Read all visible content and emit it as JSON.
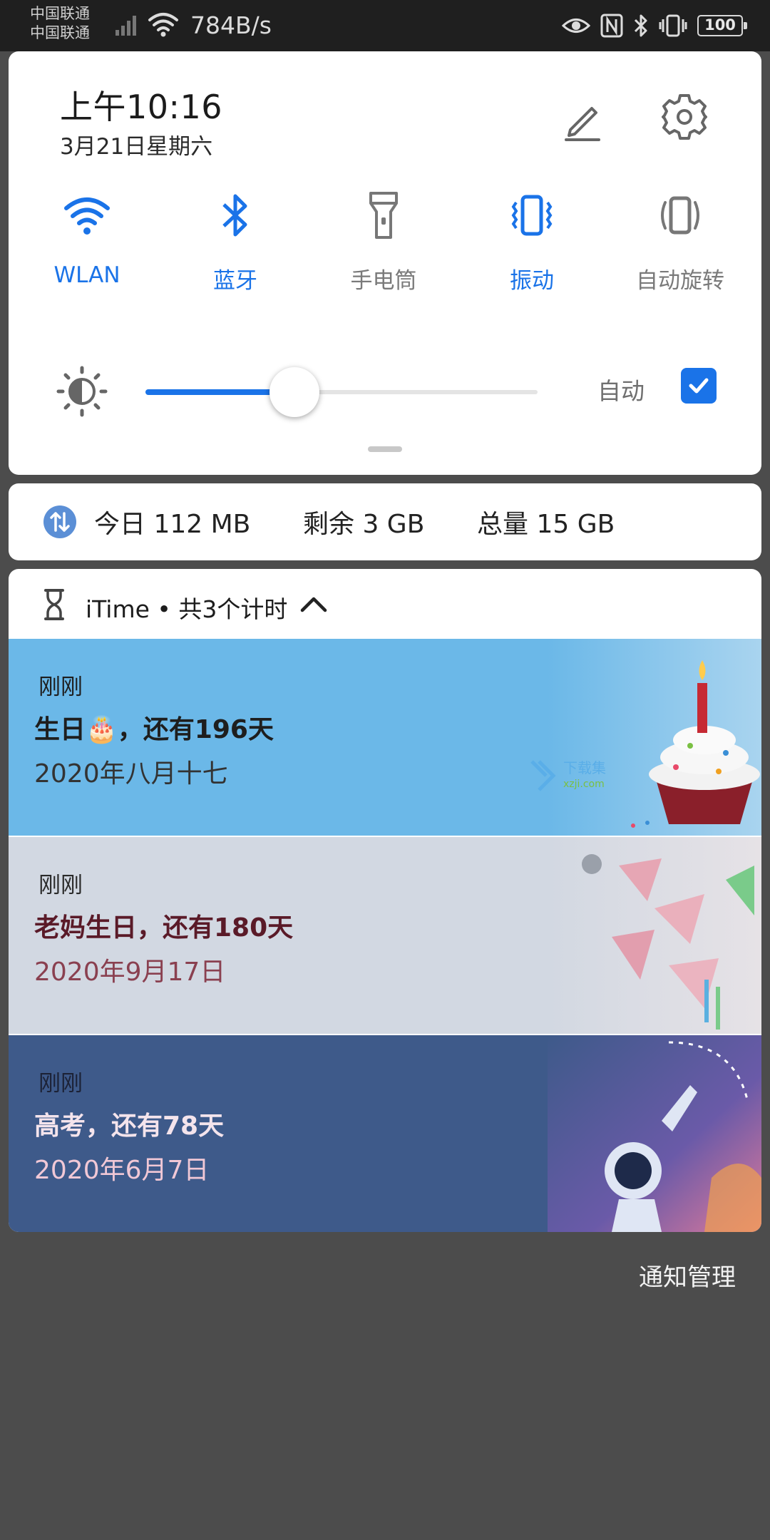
{
  "status_bar": {
    "carrier_1": "中国联通",
    "carrier_2": "中国联通",
    "net_speed": "784B/s",
    "battery": "100"
  },
  "header": {
    "time": "上午10:16",
    "date": "3月21日星期六"
  },
  "tiles": [
    {
      "label": "WLAN",
      "icon": "wifi-icon",
      "active": true
    },
    {
      "label": "蓝牙",
      "icon": "bluetooth-icon",
      "active": true
    },
    {
      "label": "手电筒",
      "icon": "flashlight-icon",
      "active": false
    },
    {
      "label": "振动",
      "icon": "vibrate-icon",
      "active": true
    },
    {
      "label": "自动旋转",
      "icon": "rotate-icon",
      "active": false
    }
  ],
  "brightness": {
    "level": 0.38,
    "auto_label": "自动",
    "auto_checked": true
  },
  "data_usage": {
    "today": "今日 112 MB",
    "remaining": "剩余 3 GB",
    "total": "总量 15 GB"
  },
  "notification": {
    "app_title": "iTime • 共3个计时",
    "cards": [
      {
        "when": "刚刚",
        "title": "生日🎂，还有196天",
        "subtitle": "2020年八月十七"
      },
      {
        "when": "刚刚",
        "title": "老妈生日，还有180天",
        "subtitle": "2020年9月17日"
      },
      {
        "when": "刚刚",
        "title": "高考，还有78天",
        "subtitle": "2020年6月7日"
      }
    ]
  },
  "watermark": {
    "name": "下载集",
    "domain": "xzji.com"
  },
  "footer": {
    "manage_label": "通知管理"
  },
  "colors": {
    "accent": "#1a73e8",
    "card_1": "#6bb8e8",
    "card_2": "#d2d8e2",
    "card_3": "#3e5a8a"
  }
}
